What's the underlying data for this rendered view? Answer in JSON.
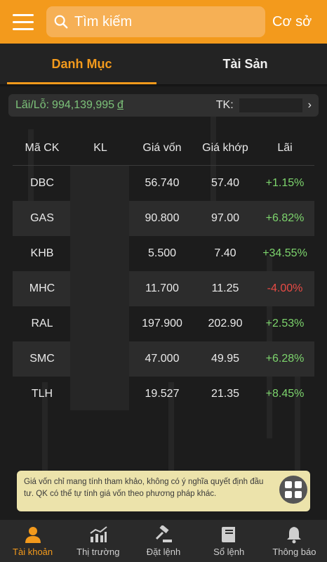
{
  "header": {
    "search_placeholder": "Tìm kiếm",
    "right_button": "Cơ sở"
  },
  "tabs": [
    {
      "label": "Danh Mục",
      "active": true
    },
    {
      "label": "Tài Sản",
      "active": false
    }
  ],
  "summary": {
    "pl_label": "Lãi/Lỗ:",
    "pl_value": "994,139,995",
    "pl_currency": "đ",
    "account_label": "TK:",
    "account_chevron": "›"
  },
  "table": {
    "headers": [
      "Mã CK",
      "KL",
      "Giá vốn",
      "Giá khớp",
      "Lãi"
    ],
    "rows": [
      {
        "symbol": "DBC",
        "cost": "56.740",
        "match": "57.40",
        "profit": "+1.15%"
      },
      {
        "symbol": "GAS",
        "cost": "90.800",
        "match": "97.00",
        "profit": "+6.82%"
      },
      {
        "symbol": "KHB",
        "cost": "5.500",
        "match": "7.40",
        "profit": "+34.55%"
      },
      {
        "symbol": "MHC",
        "cost": "11.700",
        "match": "11.25",
        "profit": "-4.00%"
      },
      {
        "symbol": "RAL",
        "cost": "197.900",
        "match": "202.90",
        "profit": "+2.53%"
      },
      {
        "symbol": "SMC",
        "cost": "47.000",
        "match": "49.95",
        "profit": "+6.28%"
      },
      {
        "symbol": "TLH",
        "cost": "19.527",
        "match": "21.35",
        "profit": "+8.45%"
      }
    ]
  },
  "notice": {
    "text": "Giá vốn chỉ mang tính tham khảo, không có ý nghĩa quyết định đầu tư. QK có thể tự tính giá vốn theo phương pháp khác."
  },
  "bottom_nav": [
    {
      "label": "Tài khoản",
      "icon": "person-icon",
      "active": true
    },
    {
      "label": "Thị trường",
      "icon": "chart-icon",
      "active": false
    },
    {
      "label": "Đặt lệnh",
      "icon": "gavel-icon",
      "active": false
    },
    {
      "label": "Sổ lệnh",
      "icon": "book-icon",
      "active": false
    },
    {
      "label": "Thông báo",
      "icon": "bell-icon",
      "active": false
    }
  ],
  "colors": {
    "accent": "#f39a1c",
    "gain": "#7dd56d",
    "loss": "#e84b45"
  }
}
